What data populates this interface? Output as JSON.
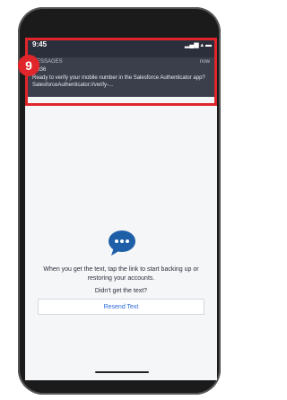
{
  "status": {
    "time": "9:45",
    "icons": "▂▄▆ ▴ ▬"
  },
  "notification": {
    "app": "MESSAGES",
    "time_ago": "now",
    "sender": "6-836",
    "body": "Ready to verify your mobile number in the Salesforce Authenticator app? SalesforceAuthenticator://verify-..."
  },
  "annotation": {
    "number": "9",
    "color": "#e0262a"
  },
  "main": {
    "message": "When you get the text, tap the link to start backing up or restoring your accounts.",
    "didnt_get": "Didn't get the text?",
    "resend_label": "Resend Text"
  },
  "colors": {
    "accent": "#2a6ad9",
    "chat_icon": "#1f5fa8"
  }
}
